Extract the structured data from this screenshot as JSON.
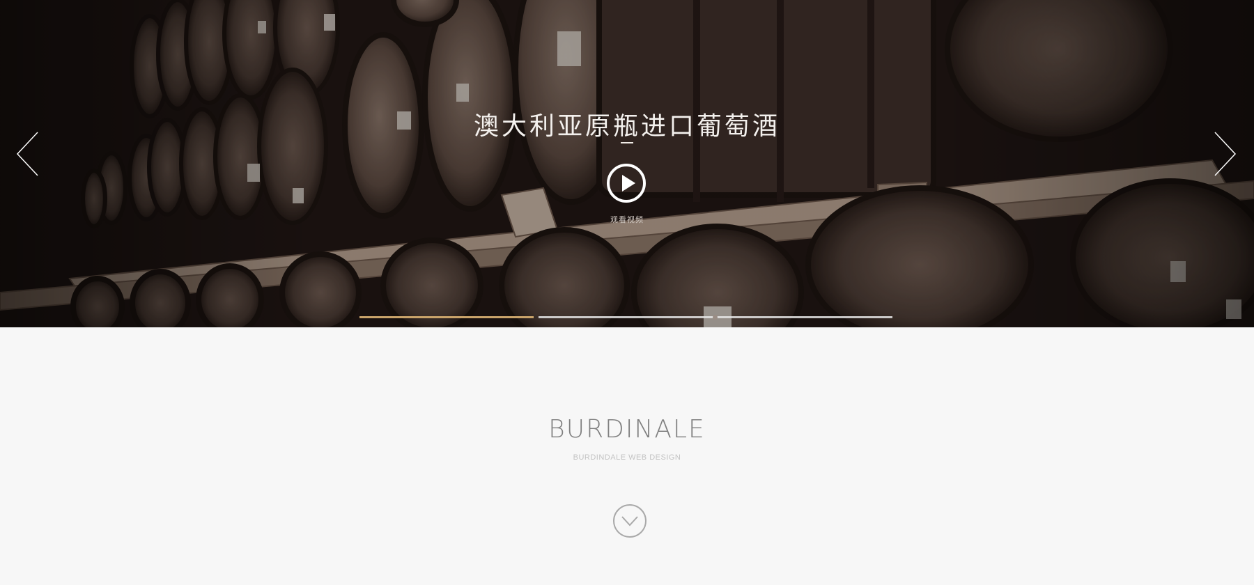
{
  "hero": {
    "title": "澳大利亚原瓶进口葡萄酒",
    "watch_video_label": "观看视频",
    "prev_icon": "chevron-left-icon",
    "next_icon": "chevron-right-icon",
    "play_icon": "play-icon",
    "slides_progress": [
      {
        "active": true,
        "fill_fraction": 1.0
      },
      {
        "active": false,
        "fill_fraction": 0.0
      }
    ]
  },
  "intro": {
    "brand_name": "BURDINALE",
    "brand_subtitle": "BURDINDALE WEB DESIGN",
    "scroll_icon": "chevron-down-icon"
  },
  "colors": {
    "accent": "#caa46a",
    "page_background": "#f7f7f7",
    "hero_dark": "#1b1212"
  }
}
